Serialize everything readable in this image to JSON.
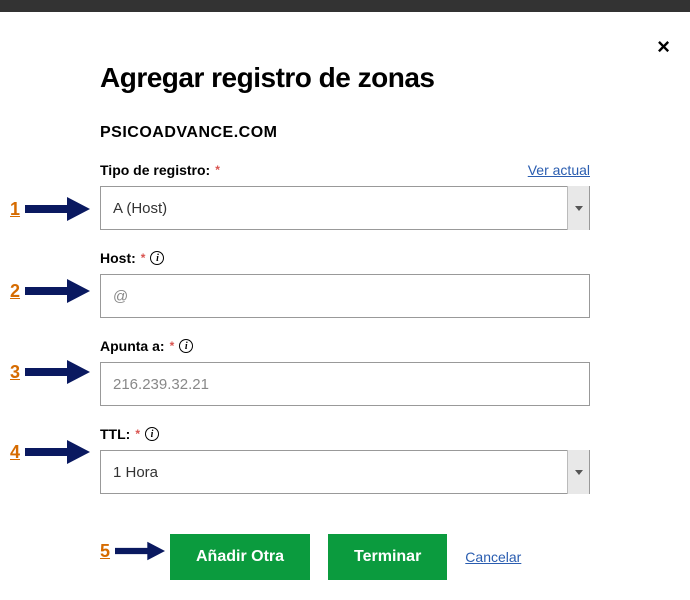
{
  "title": "Agregar registro de zonas",
  "domain": "PSICOADVANCE.COM",
  "close_symbol": "×",
  "annotations": {
    "1": "1",
    "2": "2",
    "3": "3",
    "4": "4",
    "5": "5"
  },
  "fields": {
    "tipo": {
      "label": "Tipo de registro:",
      "value": "A (Host)",
      "info": false,
      "view_link": "Ver actual"
    },
    "host": {
      "label": "Host:",
      "value": "@",
      "info": true
    },
    "apunta": {
      "label": "Apunta a:",
      "value": "216.239.32.21",
      "info": true
    },
    "ttl": {
      "label": "TTL:",
      "value": "1 Hora",
      "info": true
    }
  },
  "actions": {
    "add": "Añadir Otra",
    "finish": "Terminar",
    "cancel": "Cancelar"
  }
}
